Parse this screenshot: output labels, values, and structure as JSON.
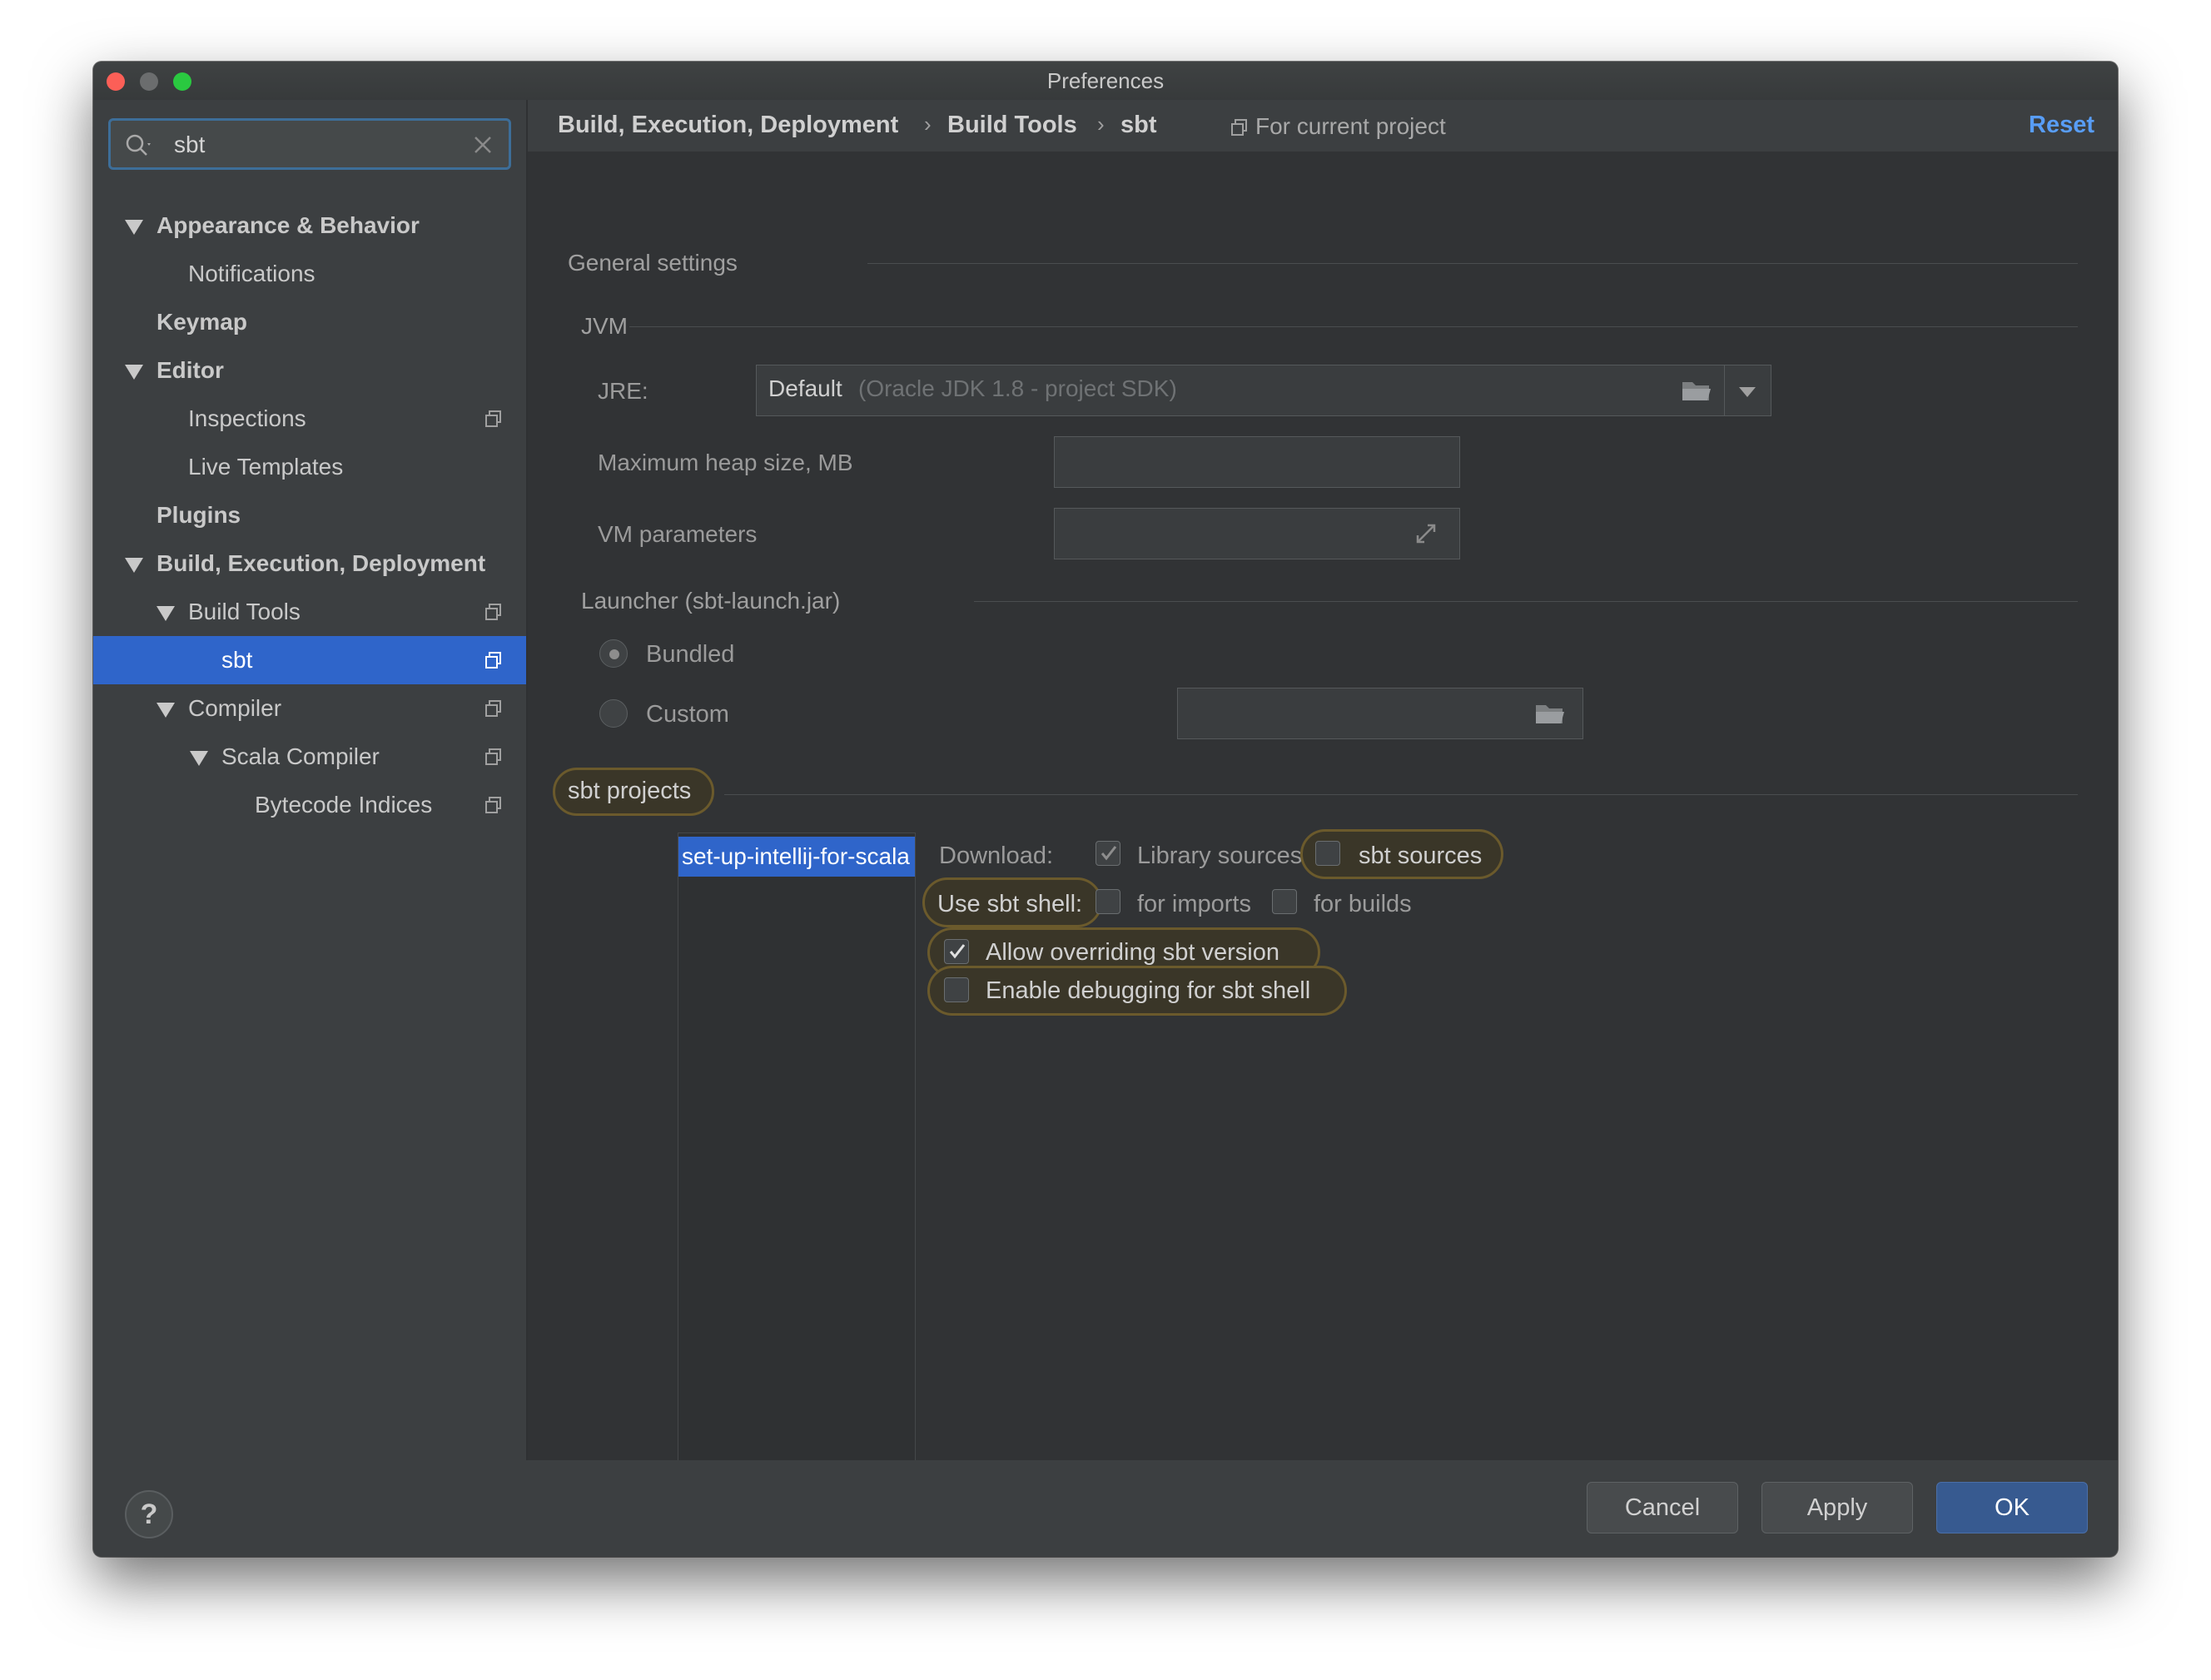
{
  "window": {
    "title": "Preferences"
  },
  "search": {
    "value": "sbt"
  },
  "tree": [
    {
      "label": "Appearance & Behavior"
    },
    {
      "label": "Notifications"
    },
    {
      "label": "Keymap"
    },
    {
      "label": "Editor"
    },
    {
      "label": "Inspections"
    },
    {
      "label": "Live Templates"
    },
    {
      "label": "Plugins"
    },
    {
      "label": "Build, Execution, Deployment"
    },
    {
      "label": "Build Tools"
    },
    {
      "label": "sbt"
    },
    {
      "label": "Compiler"
    },
    {
      "label": "Scala Compiler"
    },
    {
      "label": "Bytecode Indices"
    }
  ],
  "breadcrumb": {
    "items": [
      "Build, Execution, Deployment",
      "Build Tools",
      "sbt"
    ],
    "separator": "›",
    "scope": "For current project",
    "reset": "Reset"
  },
  "general": {
    "title": "General settings",
    "jvm_title": "JVM",
    "jre_label": "JRE:",
    "jre_value": "Default",
    "jre_detail": "(Oracle JDK 1.8 - project SDK)",
    "heap_label": "Maximum heap size, MB",
    "heap_value": "",
    "vm_label": "VM parameters",
    "vm_value": "",
    "launcher_title": "Launcher (sbt-launch.jar)",
    "bundled": "Bundled",
    "custom": "Custom",
    "custom_path": ""
  },
  "projects": {
    "title": "sbt projects",
    "list": [
      "set-up-intellij-for-scala"
    ],
    "download_label": "Download:",
    "library_sources": "Library sources",
    "sbt_sources": "sbt sources",
    "use_shell_label": "Use sbt shell:",
    "for_imports": "for imports",
    "for_builds": "for builds",
    "allow_overriding": "Allow overriding sbt version",
    "enable_debugging": "Enable debugging for sbt shell"
  },
  "footer": {
    "help": "?",
    "cancel": "Cancel",
    "apply": "Apply",
    "ok": "OK"
  },
  "colors": {
    "accent": "#2f65ca",
    "link": "#589df6",
    "highlight": "#6b5a2c"
  }
}
